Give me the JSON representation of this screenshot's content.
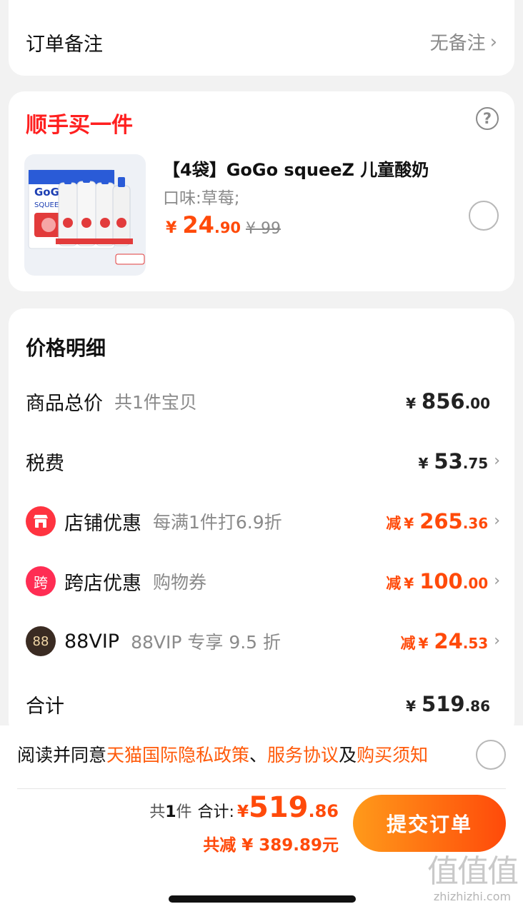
{
  "remark": {
    "label": "订单备注",
    "value": "无备注"
  },
  "addon": {
    "title": "顺手买一件",
    "help_icon": "question-circle-icon",
    "product": {
      "name": "【4袋】GoGo squeeZ 儿童酸奶",
      "flavor": "口味:草莓;",
      "price_currency": "¥",
      "price_int": "24",
      "price_dec": ".90",
      "original_price": "¥ 99",
      "image_text": "GoGo squeeZ YOGURTZ"
    }
  },
  "detail": {
    "title": "价格明细",
    "rows": [
      {
        "label": "商品总价",
        "sub": "共1件宝贝",
        "prefix": "",
        "currency": "¥",
        "int": "856",
        "dec": ".00"
      },
      {
        "label": "税费",
        "sub": "",
        "prefix": "",
        "currency": "¥",
        "int": "53",
        "dec": ".75"
      },
      {
        "label": "店铺优惠",
        "sub": "每满1件打6.9折",
        "prefix": "减",
        "currency": "¥",
        "int": "265",
        "dec": ".36"
      },
      {
        "label": "跨店优惠",
        "sub": "购物券",
        "prefix": "减",
        "currency": "¥",
        "int": "100",
        "dec": ".00",
        "badge": "跨"
      },
      {
        "label": "88VIP",
        "sub": "88VIP 专享 9.5 折",
        "prefix": "减",
        "currency": "¥",
        "int": "24",
        "dec": ".53",
        "badge": "88"
      },
      {
        "label": "合计",
        "sub": "",
        "prefix": "",
        "currency": "¥",
        "int": "519",
        "dec": ".86"
      }
    ]
  },
  "agreement": {
    "prefix": "阅读并同意",
    "link1": "天猫国际隐私政策",
    "sep": "、",
    "link2": "服务协议",
    "and": "及",
    "link3": "购买须知"
  },
  "footer": {
    "count_prefix": "共",
    "count": "1",
    "count_suffix": "件",
    "total_label": "合计:",
    "currency": "¥",
    "total_int": "519",
    "total_dec": ".86",
    "saved": "共减 ¥ 389.89元",
    "submit": "提交订单"
  },
  "watermark": {
    "big": "值值值",
    "small": "zhizhizhi.com"
  },
  "colors": {
    "accent": "#ff4a0a",
    "title_red": "#ff1f1f",
    "muted": "#8a8a8a"
  }
}
